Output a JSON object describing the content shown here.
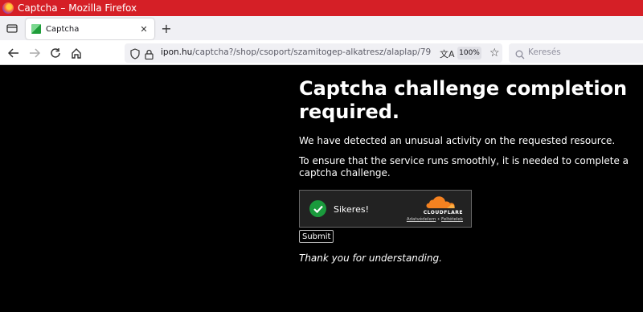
{
  "window": {
    "title": "Captcha – Mozilla Firefox"
  },
  "tabs": [
    {
      "title": "Captcha"
    }
  ],
  "nav": {
    "url_domain": "ipon.hu",
    "url_path": "/captcha?/shop/csoport/szamitogep-alkatresz/alaplap/79",
    "zoom": "100%",
    "search_placeholder": "Keresés"
  },
  "page": {
    "heading": "Captcha challenge completion required.",
    "paragraph1": "We have detected an unusual activity on the requested resource.",
    "paragraph2": "To ensure that the service runs smoothly, it is needed to complete a captcha challenge.",
    "captcha": {
      "status": "Sikeres!",
      "brand": "CLOUDFLARE",
      "link_privacy": "Adatvédelem",
      "separator": "•",
      "link_terms": "Feltételek"
    },
    "submit_label": "Submit",
    "thanks": "Thank you for understanding."
  },
  "colors": {
    "titlebar": "#d51f26",
    "success": "#1a9a3c",
    "cloudflare_orange": "#f48120"
  }
}
